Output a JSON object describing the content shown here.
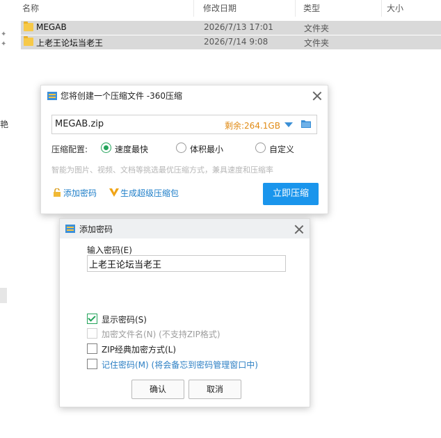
{
  "columns": {
    "name": "名称",
    "date": "修改日期",
    "type": "类型",
    "size": "大小"
  },
  "files": [
    {
      "name": "MEGAB",
      "date": "2026/7/13 17:01",
      "type": "文件夹"
    },
    {
      "name": "上老王论坛当老王",
      "date": "2026/7/14 9:08",
      "type": "文件夹"
    }
  ],
  "sidebar": {
    "partial_text": "艳"
  },
  "compress_dialog": {
    "title": "您将创建一个压缩文件 -360压缩",
    "filename": "MEGAB.zip",
    "remaining": "剩余:264.1GB",
    "config_label": "压缩配置:",
    "options": [
      "速度最快",
      "体积最小",
      "自定义"
    ],
    "selected_option": "速度最快",
    "hint": "智能为图片、视频、文档等挑选最优压缩方式，兼具速度和压缩率",
    "add_password": "添加密码",
    "super_package": "生成超级压缩包",
    "compress_button": "立即压缩"
  },
  "password_dialog": {
    "title": "添加密码",
    "prompt": "输入密码(E)",
    "password_value": "上老王论坛当老王",
    "checkboxes": [
      {
        "label": "显示密码(S)",
        "checked": true,
        "enabled": true
      },
      {
        "label": "加密文件名(N) (不支持ZIP格式)",
        "checked": false,
        "enabled": false
      },
      {
        "label": "ZIP经典加密方式(L)",
        "checked": false,
        "enabled": true
      },
      {
        "label": "记住密码(M) (将会备忘到密码管理窗口中)",
        "checked": false,
        "enabled": true
      }
    ],
    "ok_button": "确认",
    "cancel_button": "取消"
  },
  "colors": {
    "accent": "#1a95ec",
    "remaining": "#e08a14",
    "link": "#1e7ec8",
    "check": "#23a35a"
  }
}
